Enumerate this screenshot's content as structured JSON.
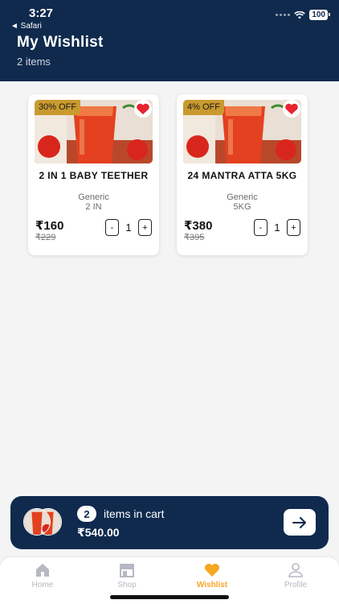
{
  "status": {
    "time": "3:27",
    "back_app": "◄ Safari",
    "battery": "100"
  },
  "header": {
    "title": "My Wishlist",
    "subtitle": "2 items"
  },
  "products": [
    {
      "discount": "30% OFF",
      "name": "2 IN 1 BABY TEETHER",
      "brand": "Generic",
      "unit": "2 IN",
      "price": "₹160",
      "mrp": "₹229",
      "qty": "1",
      "minus": "-",
      "plus": "+"
    },
    {
      "discount": "4% OFF",
      "name": "24 MANTRA ATTA 5KG",
      "brand": "Generic",
      "unit": "5KG",
      "price": "₹380",
      "mrp": "₹395",
      "qty": "1",
      "minus": "-",
      "plus": "+"
    }
  ],
  "cart": {
    "count": "2",
    "label": "items in cart",
    "total": "₹540.00"
  },
  "tabs": [
    {
      "label": "Home",
      "icon": "home-icon"
    },
    {
      "label": "Shop",
      "icon": "shop-icon"
    },
    {
      "label": "Wishlist",
      "icon": "heart-icon",
      "active": true
    },
    {
      "label": "Profile",
      "icon": "profile-icon"
    }
  ],
  "colors": {
    "header_bg": "#0f2a4d",
    "accent": "#f5a623",
    "heart": "#e8232f",
    "discount_badge": "#c99a2e"
  }
}
